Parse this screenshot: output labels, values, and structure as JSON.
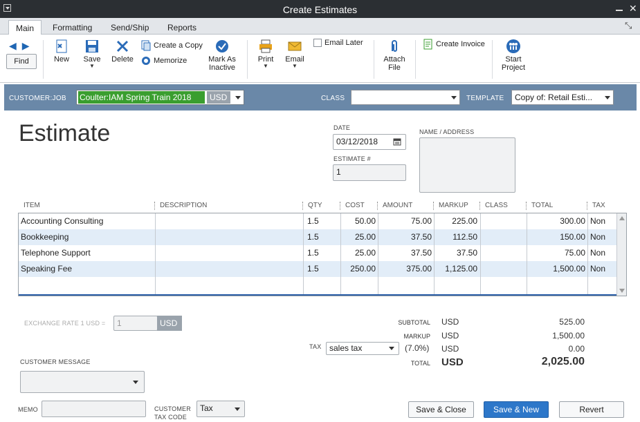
{
  "window": {
    "title": "Create Estimates"
  },
  "tabs": [
    {
      "label": "Main",
      "active": true
    },
    {
      "label": "Formatting"
    },
    {
      "label": "Send/Ship"
    },
    {
      "label": "Reports"
    }
  ],
  "toolbar": {
    "find": "Find",
    "new": "New",
    "save": "Save",
    "delete": "Delete",
    "create_copy": "Create a Copy",
    "memorize": "Memorize",
    "mark_as_inactive_1": "Mark As",
    "mark_as_inactive_2": "Inactive",
    "print": "Print",
    "email": "Email",
    "email_later": "Email Later",
    "attach_file_1": "Attach",
    "attach_file_2": "File",
    "create_invoice": "Create Invoice",
    "start_project_1": "Start",
    "start_project_2": "Project"
  },
  "customer_bar": {
    "customer_job_label": "CUSTOMER:JOB",
    "customer_job_value": "Coulter:IAM Spring Train 2018",
    "currency": "USD",
    "class_label": "CLASS",
    "class_value": "",
    "template_label": "TEMPLATE",
    "template_value": "Copy of: Retail Esti..."
  },
  "form": {
    "title": "Estimate",
    "date_label": "DATE",
    "date_value": "03/12/2018",
    "estimate_no_label": "ESTIMATE #",
    "estimate_no_value": "1",
    "name_address_label": "NAME / ADDRESS"
  },
  "table": {
    "headers": [
      "ITEM",
      "DESCRIPTION",
      "QTY",
      "COST",
      "AMOUNT",
      "MARKUP",
      "CLASS",
      "TOTAL",
      "TAX"
    ],
    "rows": [
      {
        "item": "Accounting Consulting",
        "description": "",
        "qty": "1.5",
        "cost": "50.00",
        "amount": "75.00",
        "markup": "225.00",
        "class": "",
        "total": "300.00",
        "tax": "Non"
      },
      {
        "item": "Bookkeeping",
        "description": "",
        "qty": "1.5",
        "cost": "25.00",
        "amount": "37.50",
        "markup": "112.50",
        "class": "",
        "total": "150.00",
        "tax": "Non"
      },
      {
        "item": "Telephone Support",
        "description": "",
        "qty": "1.5",
        "cost": "25.00",
        "amount": "37.50",
        "markup": "37.50",
        "class": "",
        "total": "75.00",
        "tax": "Non"
      },
      {
        "item": "Speaking Fee",
        "description": "",
        "qty": "1.5",
        "cost": "250.00",
        "amount": "375.00",
        "markup": "1,125.00",
        "class": "",
        "total": "1,500.00",
        "tax": "Non"
      }
    ]
  },
  "footer": {
    "exchange_rate_label": "EXCHANGE RATE 1 USD =",
    "exchange_rate_value": "1",
    "exchange_rate_currency": "USD",
    "customer_message_label": "CUSTOMER MESSAGE",
    "memo_label": "MEMO",
    "customer_tax_code_label_1": "CUSTOMER",
    "customer_tax_code_label_2": "TAX CODE",
    "customer_tax_code_value": "Tax",
    "tax_label": "TAX",
    "tax_value": "sales tax",
    "tax_rate": "(7.0%)",
    "subtotal_label": "SUBTOTAL",
    "markup_label": "MARKUP",
    "total_label": "TOTAL",
    "currency": "USD",
    "subtotal": "525.00",
    "markup": "1,500.00",
    "tax_amount": "0.00",
    "total": "2,025.00"
  },
  "buttons": {
    "save_close": "Save & Close",
    "save_new": "Save & New",
    "revert": "Revert"
  }
}
